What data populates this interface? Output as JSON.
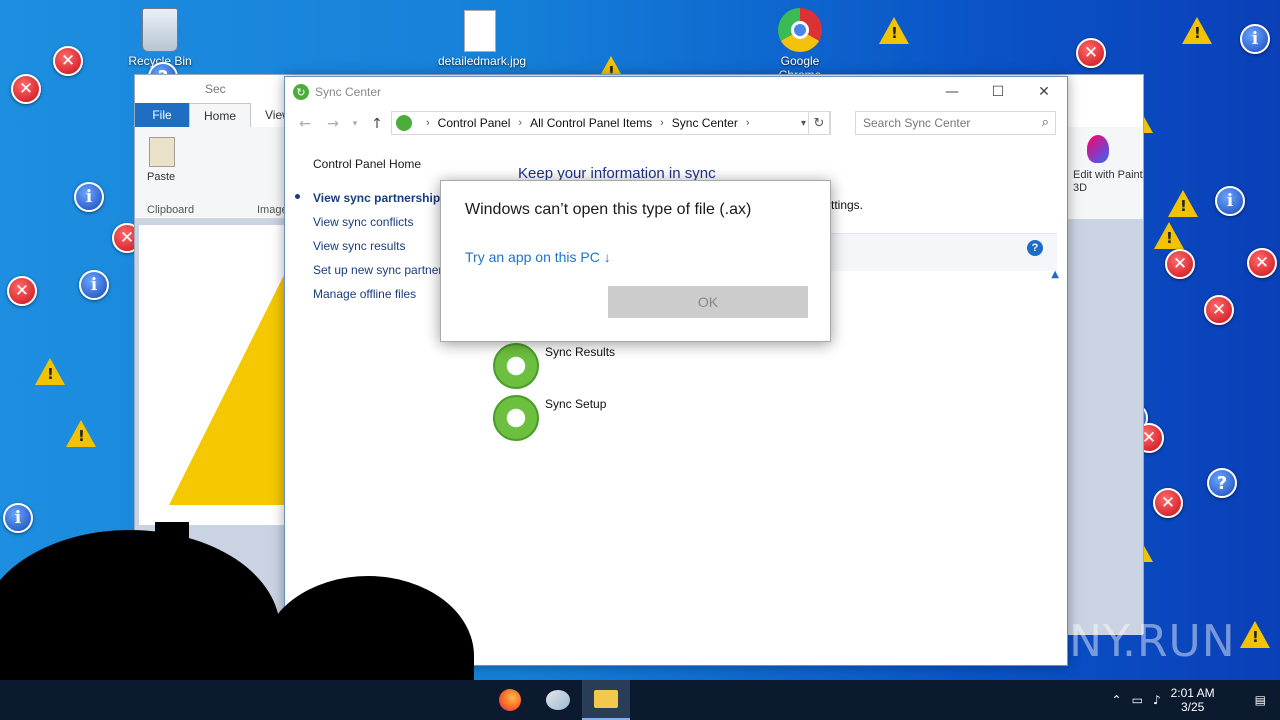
{
  "desktop": {
    "icons": [
      {
        "label": "Recycle Bin"
      },
      {
        "label": "detailedmark.jpg"
      },
      {
        "label": "Google Chrome"
      }
    ]
  },
  "paint_window": {
    "title": "Sec",
    "tabs": [
      "File",
      "Home",
      "View"
    ],
    "groups": [
      "Clipboard",
      "Image"
    ],
    "paste_label": "Paste",
    "side_label": "Edit with Paint 3D"
  },
  "sync_window": {
    "title": "Sync Center",
    "breadcrumbs": [
      "Control Panel",
      "All Control Panel Items",
      "Sync Center"
    ],
    "search_placeholder": "Search Sync Center",
    "sidebar": {
      "home": "Control Panel Home",
      "links": [
        "View sync partnerships",
        "View sync conflicts",
        "View sync results",
        "Set up new sync partner",
        "Manage offline files"
      ]
    },
    "heading": "Keep your information in sync",
    "subtext": "ttings.",
    "items": [
      "Sync Results",
      "Sync Setup"
    ]
  },
  "dialog": {
    "message": "Windows can’t open this type of file (.ax)",
    "link": "Try an app on this PC ↓",
    "ok_label": "OK"
  },
  "taskbar": {
    "time": "2:01 AM",
    "date": "3/25"
  },
  "watermark": "ANY.RUN",
  "colors": {
    "desktop_blue": "#1580d8",
    "link_blue": "#1f73c8",
    "taskbar": "#0b1a2e"
  }
}
